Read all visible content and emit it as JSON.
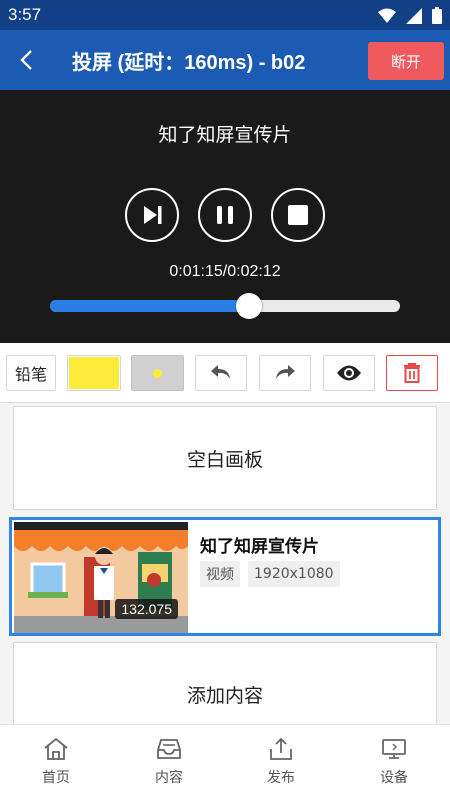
{
  "status_bar": {
    "time": "3:57",
    "icons": [
      "wifi-icon",
      "signal-icon",
      "battery-icon"
    ]
  },
  "app_bar": {
    "title": "投屏 (延时：160ms) - b02",
    "disconnect_label": "断开"
  },
  "player": {
    "title": "知了知屏宣传片",
    "time": "0:01:15/0:02:12",
    "progress": 0.568,
    "controls": [
      "skip-next-icon",
      "pause-icon",
      "stop-icon"
    ]
  },
  "toolbar": {
    "pen_label": "铅笔",
    "pen_color": "#ffeb3b",
    "dot_color": "#ffeb3b",
    "tools": [
      "undo-icon",
      "redo-icon",
      "eye-icon",
      "trash-icon"
    ]
  },
  "content": {
    "blank_board_label": "空白画板",
    "video": {
      "title": "知了知屏宣传片",
      "type_tag": "视频",
      "resolution_tag": "1920x1080",
      "duration": "132.075"
    },
    "add_content_label": "添加内容"
  },
  "bottom_nav": {
    "items": [
      {
        "label": "首页",
        "icon": "home-icon"
      },
      {
        "label": "内容",
        "icon": "inbox-icon"
      },
      {
        "label": "发布",
        "icon": "share-icon"
      },
      {
        "label": "设备",
        "icon": "monitor-icon"
      }
    ]
  },
  "colors": {
    "primary": "#1b5bb4",
    "danger": "#ef5a5f",
    "accent": "#2b86e6"
  }
}
